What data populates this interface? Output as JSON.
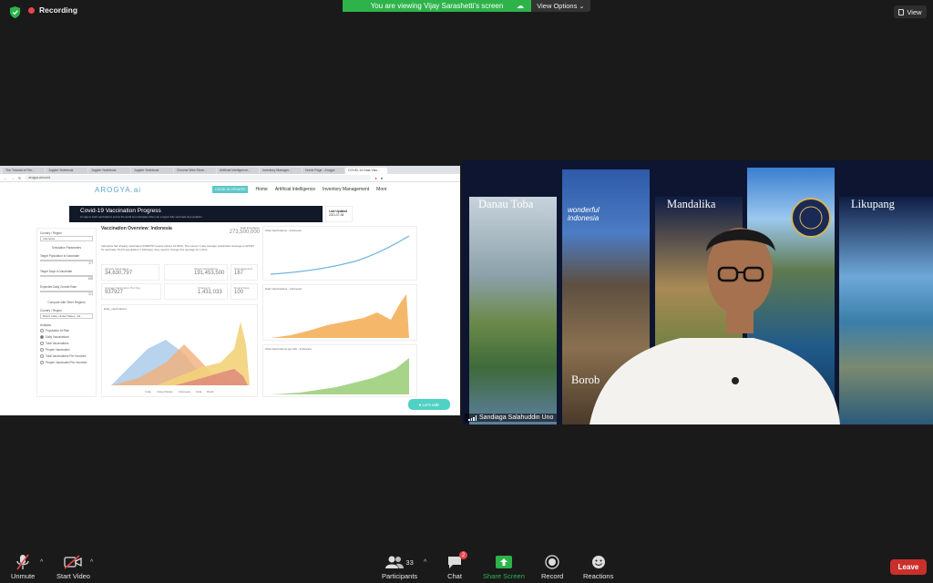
{
  "top": {
    "recording_label": "Recording",
    "banner_text": "You are viewing Vijay Sarashetti's screen",
    "view_options_label": "View Options",
    "view_label": "View"
  },
  "browser": {
    "tabs": [
      "The Tutorial of File...",
      "Jupyter Notebook",
      "Jupyter Notebook",
      "Jupyter Notebook",
      "Chrome Web Store...",
      "Artificial Intelligence...",
      "Inventory Manager...",
      "Home Page - Arogya",
      "COVID-19 Data Visu..."
    ],
    "url": "arogya.ai/covid"
  },
  "site": {
    "logo": "AROGYA.ai",
    "nav_button": "COVID-19 UPDATES",
    "nav": [
      "Home",
      "Artificial Intelligence",
      "Inventory Management",
      "More"
    ],
    "hero_title": "Covid-19 Vaccination Progress",
    "hero_sub": "An app to track vaccinations across the world and anticipate when can a region fully vaccinate its population.",
    "last_updated_label": "Last Updated",
    "last_updated_date": "2021-07-06",
    "sidebar": {
      "country_label": "Country / Region",
      "country_value": "Indonesia",
      "sim_params": "Simulation Parameters",
      "target_pop_label": "Target Population to Vaccinate",
      "target_pop_value": "0.7",
      "target_days_label": "Target Days to Vaccinate",
      "target_days_value": "100",
      "growth_label": "Expected Daily Growth Rate",
      "growth_value": "0.1",
      "compare_label": "Compare with Other Regions",
      "country2_label": "Country / Region",
      "country2_value": "Brazil, India, United States, Ind...",
      "analysis_label": "Analysis",
      "analysis_options": [
        "Population At Risk",
        "Daily Vaccinations",
        "Total Vaccinations",
        "People Vaccinated",
        "Total Vaccinations Per Hundred",
        "People Vaccinated Per Hundred"
      ]
    },
    "overview_title": "Vaccination Overview: Indonesia",
    "total_pop_label": "Total Population",
    "total_pop_value": "273,500,000",
    "description": "Indonesia has already vaccinated 34630797 people (about 12.66%). The current 7-day average vaccination average is 937927 To vaccinate 70.0% population in 100 days, they need to change this average by 1.41%.",
    "stats": [
      {
        "label": "Already Vaccinated",
        "value": "34,630,797"
      },
      {
        "label": "Target Vaccinations",
        "value": "191,453,500"
      },
      {
        "label": "Days Required",
        "value": "167"
      },
      {
        "label": "Average Vaccination Per Day",
        "value": "937927"
      },
      {
        "label": "Change In",
        "value": "1,431,033"
      },
      {
        "label": "Round Days",
        "value": "100"
      }
    ],
    "left_chart_title": "Daily_vaccinations",
    "legend": [
      "India",
      "United States",
      "Indonesia",
      "India",
      "Brazil"
    ],
    "chart_titles": [
      "Total Vaccinations - Indonesia",
      "Daily Vaccinations - Indonesia",
      "Total Vaccinations per 100 - Indonesia"
    ],
    "chat_button": "Let's talk!"
  },
  "video": {
    "titles": [
      "Danau Toba",
      "Mandalika",
      "Likupang",
      "Borob"
    ],
    "wonderful": "wonderful indonesia",
    "participant_name": "Sandiaga Salahuddin Uno"
  },
  "toolbar": {
    "unmute": "Unmute",
    "start_video": "Start Video",
    "participants": "Participants",
    "participants_count": "33",
    "chat": "Chat",
    "chat_badge": "2",
    "share_screen": "Share Screen",
    "record": "Record",
    "reactions": "Reactions",
    "leave": "Leave"
  },
  "colors": {
    "banner": "#2db34a",
    "leave": "#c9302c",
    "share": "#2db34a",
    "accent": "#5ec8c8"
  }
}
